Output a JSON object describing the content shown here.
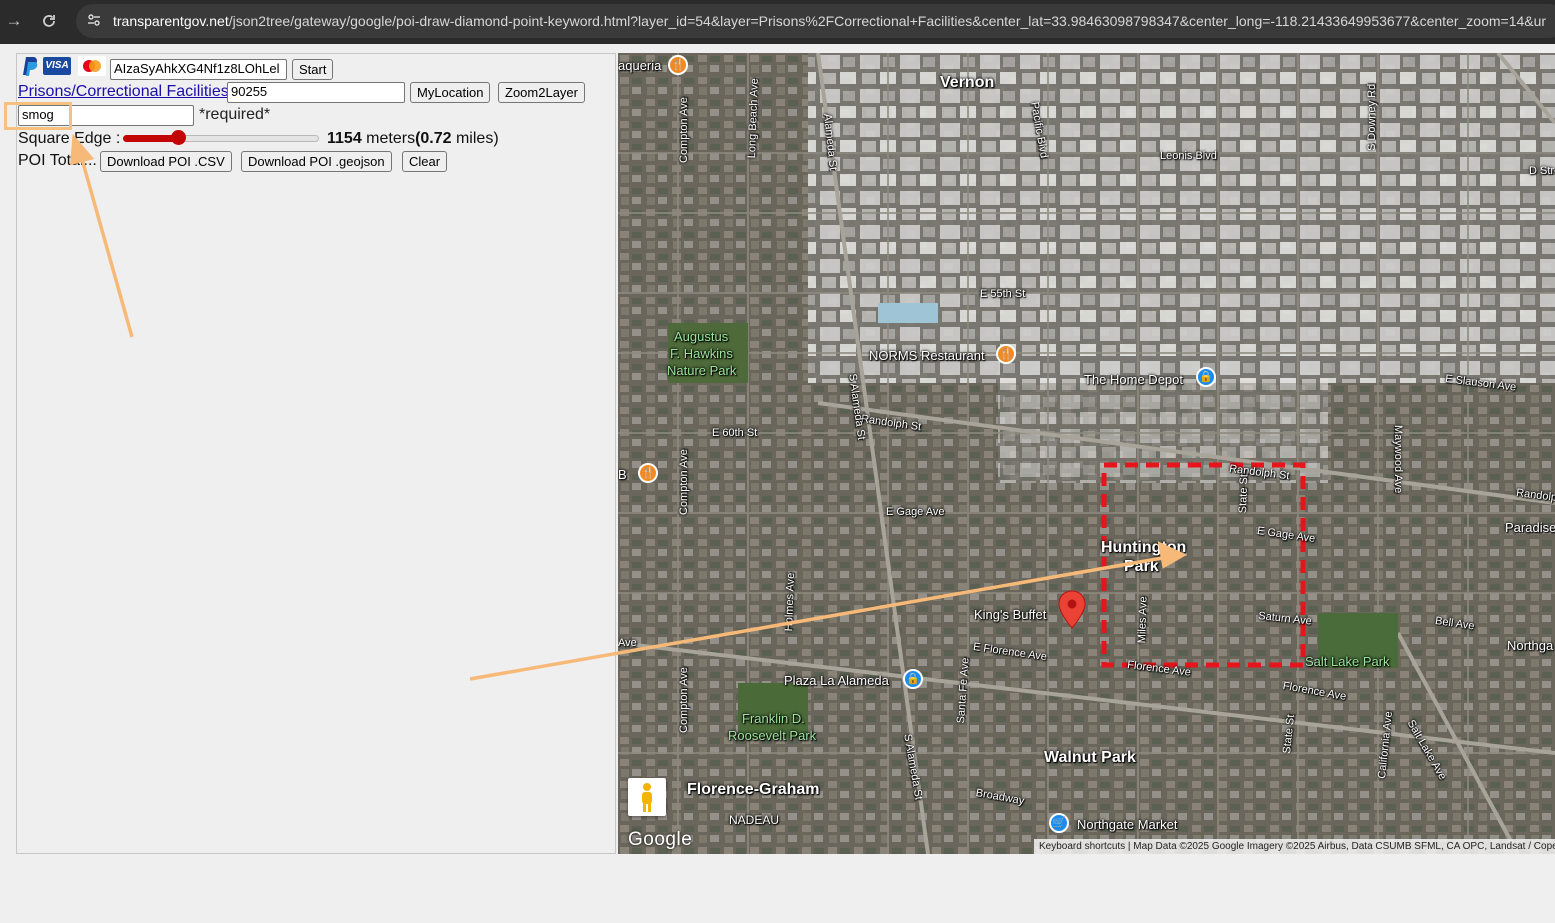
{
  "browser": {
    "back_icon": "arrow-right-icon",
    "reload_icon": "reload-icon",
    "url_host": "transparentgov.net",
    "url_path": "/json2tree/gateway/google/poi-draw-diamond-point-keyword.html?layer_id=54&layer=Prisons%2FCorrectional+Facilities&center_lat=33.98463098798347&center_long=-118.21433649953677&center_zoom=14&ur"
  },
  "panel": {
    "payment_icons": [
      "paypal-icon",
      "visa-icon",
      "mastercard-icon"
    ],
    "visa_text": "VISA",
    "api_key_value": "AIzaSyAhkXG4Nf1z8LOhLel",
    "start_label": "Start",
    "layer_link": "Prisons/Correctional Facilities",
    "zip_value": "90255",
    "mylocation_label": "MyLocation",
    "zoom2layer_label": "Zoom2Layer",
    "keyword_value": "smog",
    "required_label": "*required*",
    "square_edge_label": "Square Edge :",
    "slider_fraction": 0.28,
    "meters_value": "1154",
    "meters_unit": " meters",
    "miles_value": "(0.72",
    "miles_unit": " miles)",
    "poi_total_label": "POI Total...",
    "download_csv_label": "Download POI .CSV",
    "download_geojson_label": "Download POI .geojson",
    "clear_label": "Clear"
  },
  "map": {
    "places": {
      "vernon": "Vernon",
      "huntington": "Huntington",
      "park": "Park",
      "walnut_park": "Walnut Park",
      "florence_graham": "Florence-Graham",
      "nadeau": "NADEAU",
      "paradise": "Paradise",
      "northgate_edge": "Northga"
    },
    "pois": {
      "norms": "NORMS Restaurant",
      "home_depot": "The Home Depot",
      "kings_buffet": "King's Buffet",
      "plaza": "Plaza La Alameda",
      "northgate_market": "Northgate Market",
      "taqueria": "aqueria",
      "b_edge": "B"
    },
    "parks": {
      "augustus_1": "Augustus",
      "augustus_2": "F. Hawkins",
      "augustus_3": "Nature Park",
      "franklin_1": "Franklin D.",
      "franklin_2": "Roosevelt Park",
      "salt_lake": "Salt Lake Park"
    },
    "streets": {
      "leonis": "Leonis Blvd",
      "e55": "E 55th St",
      "slauson": "E Slauson Ave",
      "randolph": "Randolph St",
      "randolph_right": "Randolph St",
      "randolph_edge": "Randolp",
      "e60": "E 60th St",
      "e_gage": "E Gage Ave",
      "e_gage_right": "E Gage Ave",
      "saturn": "Saturn Ave",
      "bell": "Bell Ave",
      "florence_e": "E Florence Ave",
      "florence_mid": "Florence Ave",
      "florence_right": "Florence Ave",
      "broadway": "Broadway",
      "compton1": "Compton Ave",
      "compton2": "Compton Ave",
      "compton3": "Compton Ave",
      "long_beach": "Long Beach Ave",
      "alameda": "Alameda St",
      "s_alameda": "S Alameda St",
      "s_alameda2": "S Alameda St",
      "pacific": "Pacific Blvd",
      "downey": "S Downey Rd",
      "maywood": "Maywood Ave",
      "state": "State St",
      "state2": "State St",
      "miles": "Miles Ave",
      "holmes": "Holmes Ave",
      "santa_fe": "Santa Fe Ave",
      "california": "California Ave",
      "salt_lake_ave": "Salt Lake Ave",
      "d_str": "D Str",
      "ave_edge": "Ave"
    },
    "google_logo": "Google",
    "attribution": "Keyboard shortcuts  |  Map Data ©2025 Google Imagery ©2025 Airbus, Data CSUMB SFML, CA OPC, Landsat / Copernicus",
    "pegman_icon": "pegman-icon",
    "marker_icon": "map-pin-icon",
    "square_color": "#e8141c",
    "arrow_color": "#f7b978"
  }
}
